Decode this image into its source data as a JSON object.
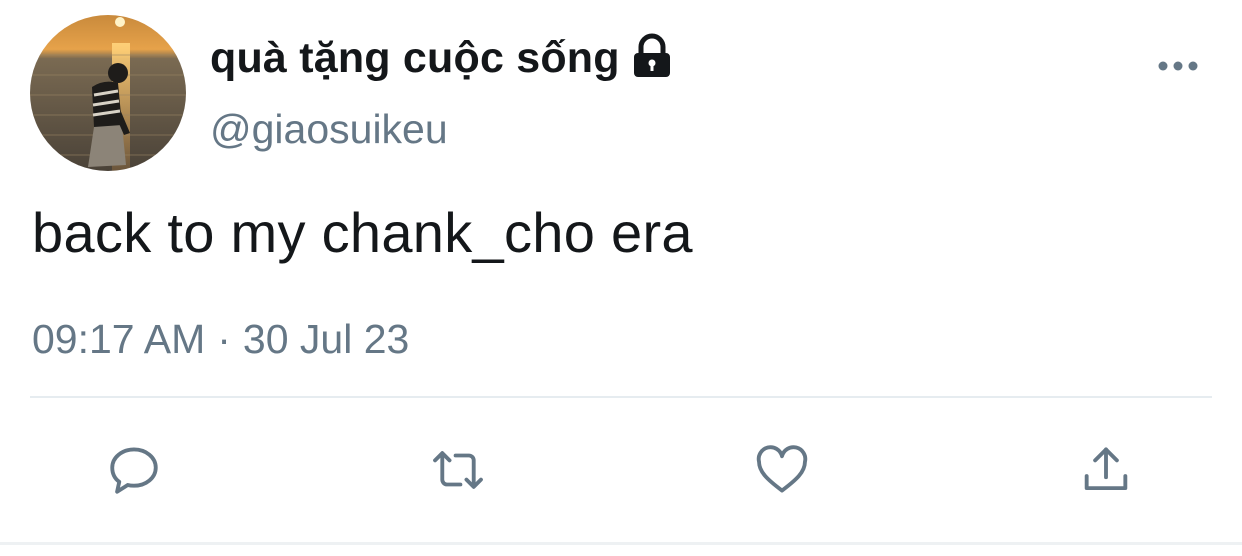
{
  "tweet": {
    "display_name": "quà tặng cuộc sống",
    "handle": "@giaosuikeu",
    "text": "back to my chank_cho era",
    "time": "09:17 AM",
    "separator": "·",
    "date": "30 Jul 23",
    "protected": true
  },
  "icons": {
    "lock": "lock-icon",
    "more": "more-horizontal-icon",
    "reply": "reply-icon",
    "retweet": "retweet-icon",
    "like": "heart-icon",
    "share": "share-icon"
  },
  "colors": {
    "text": "#14171a",
    "secondary": "#657786",
    "divider": "#e6ecf0"
  }
}
